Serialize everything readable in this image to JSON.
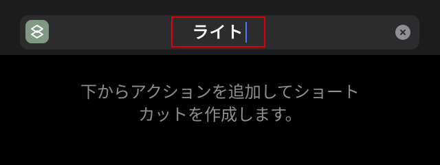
{
  "header": {
    "shortcut_name": "ライト",
    "app_icon": "shortcuts-icon",
    "clear_icon": "clear-x-icon"
  },
  "body": {
    "hint_line1": "下からアクションを追加してショート",
    "hint_line2": "カットを作成します。"
  },
  "colors": {
    "background": "#000000",
    "bar": "#2c2c2e",
    "caret": "#4a78ff",
    "highlight": "#e00000",
    "app_icon_bg": "#7f9a82",
    "hint_text": "#8e8e93"
  }
}
